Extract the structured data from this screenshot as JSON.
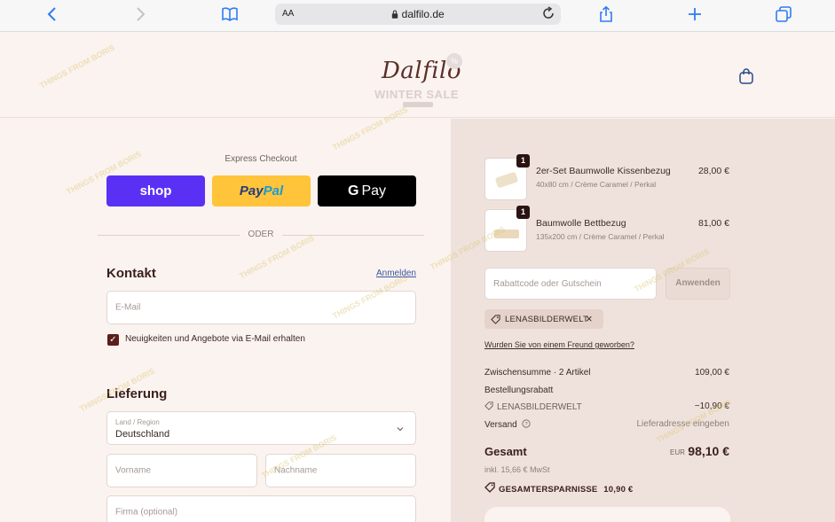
{
  "browser": {
    "text_size_label": "AA",
    "url": "dalfilo.de"
  },
  "header": {
    "logo_text": "Dalfilo",
    "sale_text": "WINTER SALE",
    "badge_text": "%"
  },
  "checkout": {
    "express_label": "Express Checkout",
    "shop_label": "shop",
    "paypal_label_1": "Pay",
    "paypal_label_2": "Pal",
    "gpay_g": "G",
    "gpay_label": "Pay",
    "divider_label": "ODER",
    "contact_title": "Kontakt",
    "login_link": "Anmelden",
    "email_placeholder": "E-Mail",
    "newsletter_label": "Neuigkeiten und Angebote via E-Mail erhalten",
    "newsletter_checked": true,
    "delivery_title": "Lieferung",
    "country_label": "Land / Region",
    "country_value": "Deutschland",
    "firstname_placeholder": "Vorname",
    "lastname_placeholder": "Nachname",
    "company_placeholder": "Firma (optional)"
  },
  "cart": {
    "items": [
      {
        "qty": "1",
        "name": "2er-Set Baumwolle Kissenbezug",
        "variant": "40x80 cm / Crème Caramel / Perkal",
        "price": "28,00 €"
      },
      {
        "qty": "1",
        "name": "Baumwolle Bettbezug",
        "variant": "135x200 cm / Crème Caramel / Perkal",
        "price": "81,00 €"
      }
    ],
    "coupon_placeholder": "Rabattcode oder Gutschein",
    "apply_label": "Anwenden",
    "applied_code": "LENASBILDERWELT",
    "friend_link": "Wurden Sie von einem Freund geworben?",
    "subtotal_label": "Zwischensumme · 2 Artikel",
    "subtotal_value": "109,00 €",
    "discount_label": "Bestellungsrabatt",
    "discount_code": "LENASBILDERWELT",
    "discount_value": "−10,90 €",
    "shipping_label": "Versand",
    "shipping_value": "Lieferadresse eingeben",
    "total_label": "Gesamt",
    "total_currency": "EUR",
    "total_value": "98,10 €",
    "tax_text": "inkl. 15,66 € MwSt",
    "savings_label": "GESAMTERSPARNISSE",
    "savings_value": "10,90 €"
  },
  "watermark": "THINGS FROM BORIS",
  "colors": {
    "shop_pay": "#5a31f4",
    "paypal": "#ffc439",
    "gpay": "#000000",
    "brand_dark": "#5a1f1c",
    "browser_accent": "#2f7cf6"
  }
}
